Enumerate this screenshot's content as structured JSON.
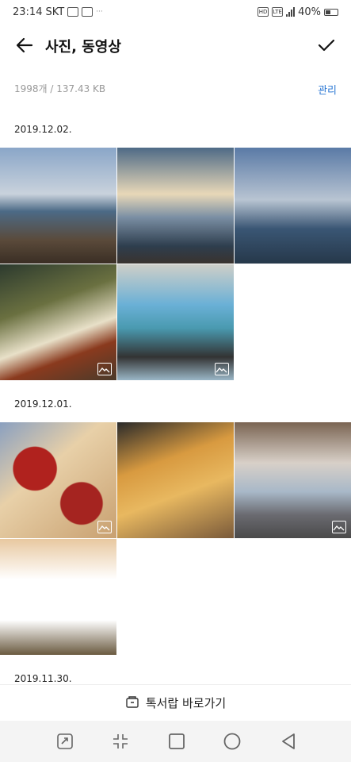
{
  "status": {
    "time": "23:14",
    "carrier": "SKT",
    "dots": "···",
    "battery": "40%",
    "hd": "HD",
    "lte": "LTE"
  },
  "header": {
    "title": "사진, 동영상"
  },
  "summary": {
    "info": "1998개 / 137.43 KB",
    "manage": "관리"
  },
  "sections": [
    {
      "date": "2019.12.02."
    },
    {
      "date": "2019.12.01."
    },
    {
      "date": "2019.11.30."
    }
  ],
  "footer": {
    "shortcut": "톡서랍 바로가기"
  },
  "colors": {
    "accent": "#2c78d4"
  },
  "icons": [
    "back-arrow-icon",
    "check-icon",
    "gallery-badge-icon",
    "drawer-icon",
    "rotate-icon",
    "compress-icon",
    "square-icon",
    "circle-icon",
    "triangle-icon"
  ]
}
